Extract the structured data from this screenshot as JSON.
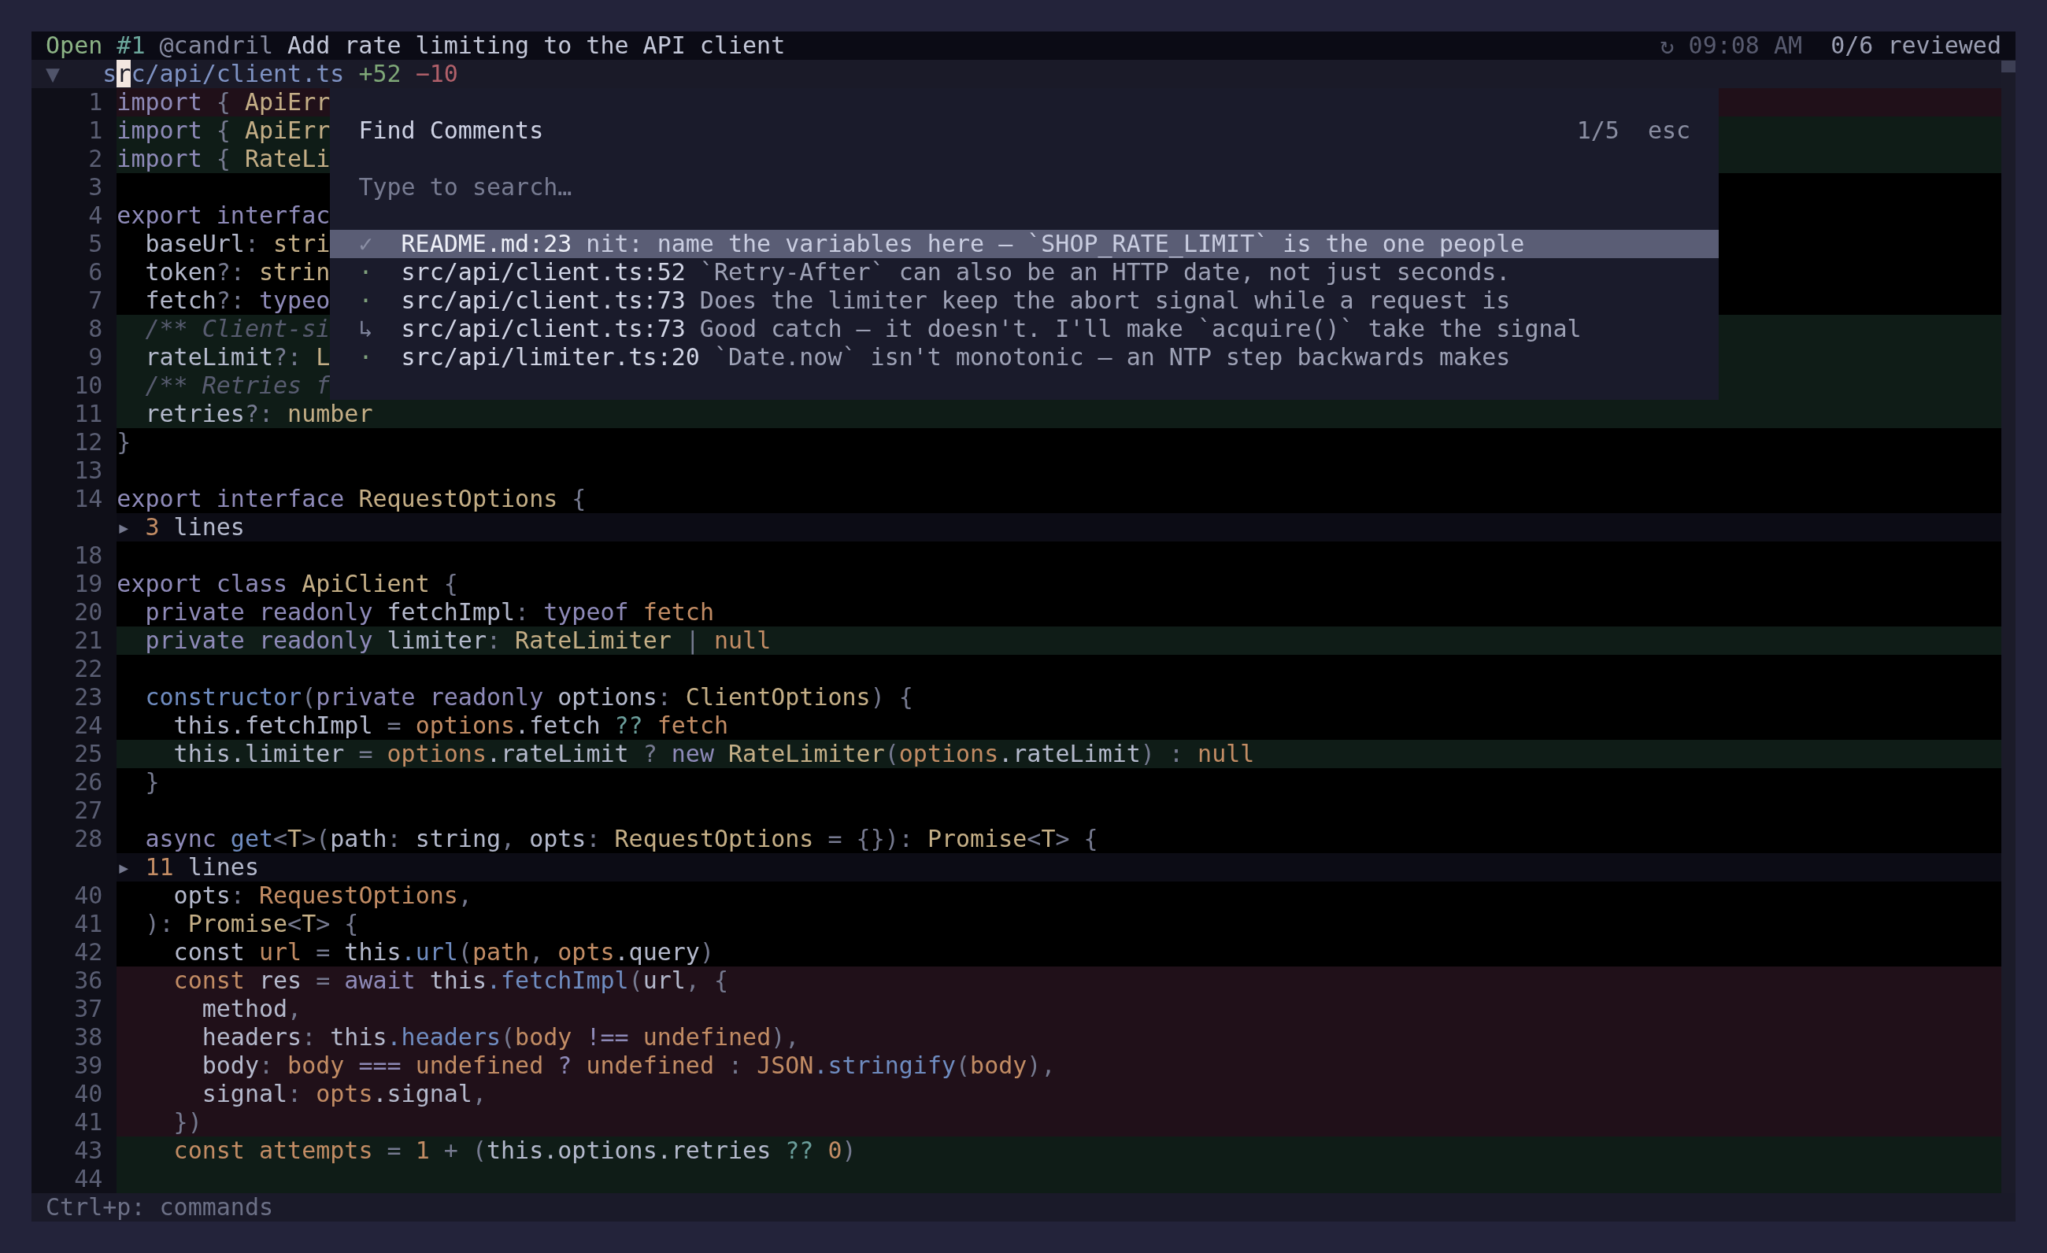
{
  "title_bar": {
    "state": "Open",
    "number": "#1",
    "author": "@candril",
    "title": "Add rate limiting to the API client",
    "refresh_glyph": "↻",
    "time": "09:08 AM",
    "reviewed_count": "0/6 reviewed"
  },
  "file_header": {
    "toggle": "▼",
    "path": [
      {
        "text": "s",
        "cursor": false
      },
      {
        "text": "r",
        "cursor": true
      },
      {
        "text": "c/api/client.ts",
        "cursor": false
      }
    ],
    "additions": "+52",
    "deletions": "−10"
  },
  "diff_lines": [
    {
      "kind": "removed",
      "number": "1",
      "code": [
        {
          "kind": "kw",
          "text": "import"
        },
        {
          "kind": "punct",
          "text": " { "
        },
        {
          "kind": "type",
          "text": "ApiErr"
        }
      ]
    },
    {
      "kind": "added",
      "number": "1",
      "code": [
        {
          "kind": "kw",
          "text": "import"
        },
        {
          "kind": "punct",
          "text": " { "
        },
        {
          "kind": "type",
          "text": "ApiErr"
        }
      ]
    },
    {
      "kind": "added",
      "number": "2",
      "code": [
        {
          "kind": "kw",
          "text": "import"
        },
        {
          "kind": "punct",
          "text": " { "
        },
        {
          "kind": "type",
          "text": "RateLi"
        }
      ]
    },
    {
      "kind": "context",
      "number": "3"
    },
    {
      "kind": "context",
      "number": "4",
      "code": [
        {
          "kind": "kw",
          "text": "export interfac"
        }
      ]
    },
    {
      "kind": "context",
      "number": "5",
      "code": [
        {
          "kind": "id",
          "text": "  baseUrl"
        },
        {
          "kind": "punct",
          "text": ": "
        },
        {
          "kind": "type",
          "text": "stri"
        }
      ]
    },
    {
      "kind": "context",
      "number": "6",
      "code": [
        {
          "kind": "id",
          "text": "  token"
        },
        {
          "kind": "punct",
          "text": "?: "
        },
        {
          "kind": "type",
          "text": "strin"
        }
      ]
    },
    {
      "kind": "context",
      "number": "7",
      "code": [
        {
          "kind": "id",
          "text": "  fetch"
        },
        {
          "kind": "punct",
          "text": "?: "
        },
        {
          "kind": "kw",
          "text": "typeo"
        }
      ]
    },
    {
      "kind": "added",
      "number": "8",
      "code": [
        {
          "kind": "cmt",
          "text": "  /** Client-si"
        }
      ]
    },
    {
      "kind": "added",
      "number": "9",
      "code": [
        {
          "kind": "id",
          "text": "  rateLimit"
        },
        {
          "kind": "punct",
          "text": "?: "
        },
        {
          "kind": "type",
          "text": "L"
        }
      ]
    },
    {
      "kind": "added",
      "number": "10",
      "code": [
        {
          "kind": "cmt",
          "text": "  /** Retries f"
        }
      ]
    },
    {
      "kind": "added",
      "number": "11",
      "code": [
        {
          "kind": "id",
          "text": "  retries"
        },
        {
          "kind": "punct",
          "text": "?: "
        },
        {
          "kind": "type",
          "text": "number"
        }
      ]
    },
    {
      "kind": "context",
      "number": "12",
      "code": [
        {
          "kind": "punct",
          "text": "}"
        }
      ]
    },
    {
      "kind": "context",
      "number": "13"
    },
    {
      "kind": "context",
      "number": "14",
      "code": [
        {
          "kind": "kw",
          "text": "export interface "
        },
        {
          "kind": "type",
          "text": "RequestOptions"
        },
        {
          "kind": "punct",
          "text": " {"
        }
      ]
    },
    {
      "kind": "fold",
      "code": [
        {
          "kind": "punct",
          "text": "▸ "
        },
        {
          "kind": "val",
          "text": "3"
        },
        {
          "kind": "id",
          "text": " lines"
        }
      ]
    },
    {
      "kind": "context",
      "number": "18"
    },
    {
      "kind": "context",
      "number": "19",
      "code": [
        {
          "kind": "kw",
          "text": "export class "
        },
        {
          "kind": "type",
          "text": "ApiClient"
        },
        {
          "kind": "punct",
          "text": " {"
        }
      ]
    },
    {
      "kind": "context",
      "number": "20",
      "code": [
        {
          "kind": "kw",
          "text": "  private readonly "
        },
        {
          "kind": "id",
          "text": "fetchImpl"
        },
        {
          "kind": "punct",
          "text": ": "
        },
        {
          "kind": "kw",
          "text": "typeof "
        },
        {
          "kind": "val",
          "text": "fetch"
        }
      ]
    },
    {
      "kind": "added",
      "number": "21",
      "code": [
        {
          "kind": "kw",
          "text": "  private readonly "
        },
        {
          "kind": "id",
          "text": "limiter"
        },
        {
          "kind": "punct",
          "text": ": "
        },
        {
          "kind": "type",
          "text": "RateLimiter"
        },
        {
          "kind": "punct",
          "text": " | "
        },
        {
          "kind": "val",
          "text": "null"
        }
      ]
    },
    {
      "kind": "context",
      "number": "22"
    },
    {
      "kind": "context",
      "number": "23",
      "code": [
        {
          "kind": "fn",
          "text": "  constructor"
        },
        {
          "kind": "punct",
          "text": "("
        },
        {
          "kind": "kw",
          "text": "private readonly "
        },
        {
          "kind": "id",
          "text": "options"
        },
        {
          "kind": "punct",
          "text": ": "
        },
        {
          "kind": "type",
          "text": "ClientOptions"
        },
        {
          "kind": "punct",
          "text": ") {"
        }
      ]
    },
    {
      "kind": "context",
      "number": "24",
      "code": [
        {
          "kind": "id",
          "text": "    this.fetchImpl"
        },
        {
          "kind": "punct",
          "text": " = "
        },
        {
          "kind": "val",
          "text": "options"
        },
        {
          "kind": "id",
          "text": ".fetch "
        },
        {
          "kind": "op",
          "text": "??"
        },
        {
          "kind": "val",
          "text": " fetch"
        }
      ]
    },
    {
      "kind": "added",
      "number": "25",
      "code": [
        {
          "kind": "id",
          "text": "    this.limiter"
        },
        {
          "kind": "punct",
          "text": " = "
        },
        {
          "kind": "val",
          "text": "options"
        },
        {
          "kind": "id",
          "text": ".rateLimit"
        },
        {
          "kind": "punct",
          "text": " ? "
        },
        {
          "kind": "kw",
          "text": "new "
        },
        {
          "kind": "type",
          "text": "RateLimiter"
        },
        {
          "kind": "punct",
          "text": "("
        },
        {
          "kind": "val",
          "text": "options"
        },
        {
          "kind": "id",
          "text": ".rateLimit"
        },
        {
          "kind": "punct",
          "text": ") : "
        },
        {
          "kind": "val",
          "text": "null"
        }
      ]
    },
    {
      "kind": "context",
      "number": "26",
      "code": [
        {
          "kind": "punct",
          "text": "  }"
        }
      ]
    },
    {
      "kind": "context",
      "number": "27"
    },
    {
      "kind": "context",
      "number": "28",
      "code": [
        {
          "kind": "kw",
          "text": "  async "
        },
        {
          "kind": "fn",
          "text": "get"
        },
        {
          "kind": "punct",
          "text": "<"
        },
        {
          "kind": "type",
          "text": "T"
        },
        {
          "kind": "punct",
          "text": ">("
        },
        {
          "kind": "id",
          "text": "path"
        },
        {
          "kind": "punct",
          "text": ": "
        },
        {
          "kind": "id",
          "text": "string"
        },
        {
          "kind": "punct",
          "text": ", "
        },
        {
          "kind": "id",
          "text": "opts"
        },
        {
          "kind": "punct",
          "text": ": "
        },
        {
          "kind": "type",
          "text": "RequestOptions"
        },
        {
          "kind": "punct",
          "text": " = {}): "
        },
        {
          "kind": "type",
          "text": "Promise"
        },
        {
          "kind": "punct",
          "text": "<"
        },
        {
          "kind": "type",
          "text": "T"
        },
        {
          "kind": "punct",
          "text": "> {"
        }
      ]
    },
    {
      "kind": "fold",
      "code": [
        {
          "kind": "punct",
          "text": "▸ "
        },
        {
          "kind": "val",
          "text": "11"
        },
        {
          "kind": "id",
          "text": " lines"
        }
      ]
    },
    {
      "kind": "context",
      "number": "40",
      "code": [
        {
          "kind": "id",
          "text": "    opts"
        },
        {
          "kind": "punct",
          "text": ": "
        },
        {
          "kind": "val",
          "text": "RequestOptions"
        },
        {
          "kind": "punct",
          "text": ","
        }
      ]
    },
    {
      "kind": "context",
      "number": "41",
      "code": [
        {
          "kind": "punct",
          "text": "  ): "
        },
        {
          "kind": "type",
          "text": "Promise"
        },
        {
          "kind": "punct",
          "text": "<"
        },
        {
          "kind": "type",
          "text": "T"
        },
        {
          "kind": "punct",
          "text": "> {"
        }
      ]
    },
    {
      "kind": "context",
      "number": "42",
      "code": [
        {
          "kind": "id",
          "text": "    const "
        },
        {
          "kind": "val",
          "text": "url"
        },
        {
          "kind": "punct",
          "text": " = "
        },
        {
          "kind": "id",
          "text": "this"
        },
        {
          "kind": "fn",
          "text": ".url"
        },
        {
          "kind": "punct",
          "text": "("
        },
        {
          "kind": "val",
          "text": "path"
        },
        {
          "kind": "punct",
          "text": ", "
        },
        {
          "kind": "val",
          "text": "opts"
        },
        {
          "kind": "id",
          "text": ".query"
        },
        {
          "kind": "punct",
          "text": ")"
        }
      ]
    },
    {
      "kind": "removed",
      "number": "36",
      "code": [
        {
          "kind": "val",
          "text": "    const "
        },
        {
          "kind": "id",
          "text": "res"
        },
        {
          "kind": "punct",
          "text": " = "
        },
        {
          "kind": "kw",
          "text": "await "
        },
        {
          "kind": "id",
          "text": "this"
        },
        {
          "kind": "fn",
          "text": ".fetchImpl"
        },
        {
          "kind": "punct",
          "text": "("
        },
        {
          "kind": "id",
          "text": "url"
        },
        {
          "kind": "punct",
          "text": ", {"
        }
      ]
    },
    {
      "kind": "removed",
      "number": "37",
      "code": [
        {
          "kind": "id",
          "text": "      method"
        },
        {
          "kind": "punct",
          "text": ","
        }
      ]
    },
    {
      "kind": "removed",
      "number": "38",
      "code": [
        {
          "kind": "id",
          "text": "      headers"
        },
        {
          "kind": "punct",
          "text": ": "
        },
        {
          "kind": "id",
          "text": "this"
        },
        {
          "kind": "fn",
          "text": ".headers"
        },
        {
          "kind": "punct",
          "text": "("
        },
        {
          "kind": "val",
          "text": "body"
        },
        {
          "kind": "kw",
          "text": " !== "
        },
        {
          "kind": "val",
          "text": "undefined"
        },
        {
          "kind": "punct",
          "text": "),"
        }
      ]
    },
    {
      "kind": "removed",
      "number": "39",
      "code": [
        {
          "kind": "id",
          "text": "      body"
        },
        {
          "kind": "punct",
          "text": ": "
        },
        {
          "kind": "val",
          "text": "body"
        },
        {
          "kind": "kw",
          "text": " === "
        },
        {
          "kind": "val",
          "text": "undefined"
        },
        {
          "kind": "kw",
          "text": " ? "
        },
        {
          "kind": "val",
          "text": "undefined"
        },
        {
          "kind": "punct",
          "text": " : "
        },
        {
          "kind": "val",
          "text": "JSON"
        },
        {
          "kind": "fn",
          "text": ".stringify"
        },
        {
          "kind": "punct",
          "text": "("
        },
        {
          "kind": "val",
          "text": "body"
        },
        {
          "kind": "punct",
          "text": "),"
        }
      ]
    },
    {
      "kind": "removed",
      "number": "40",
      "code": [
        {
          "kind": "id",
          "text": "      signal"
        },
        {
          "kind": "punct",
          "text": ": "
        },
        {
          "kind": "val",
          "text": "opts"
        },
        {
          "kind": "id",
          "text": ".signal"
        },
        {
          "kind": "punct",
          "text": ","
        }
      ]
    },
    {
      "kind": "removed",
      "number": "41",
      "code": [
        {
          "kind": "punct",
          "text": "    })"
        }
      ]
    },
    {
      "kind": "added",
      "number": "43",
      "code": [
        {
          "kind": "val",
          "text": "    const attempts"
        },
        {
          "kind": "punct",
          "text": " = "
        },
        {
          "kind": "val",
          "text": "1"
        },
        {
          "kind": "punct",
          "text": " + ("
        },
        {
          "kind": "id",
          "text": "this.options.retries "
        },
        {
          "kind": "op",
          "text": "??"
        },
        {
          "kind": "val",
          "text": " 0"
        },
        {
          "kind": "punct",
          "text": ")"
        }
      ]
    },
    {
      "kind": "added",
      "number": "44"
    }
  ],
  "find_comments": {
    "title": "Find Comments",
    "count": "1/5",
    "close_key": "esc",
    "search": {
      "placeholder": "Type to search…"
    },
    "results": [
      {
        "selected": true,
        "kind": "done",
        "marker": "✓",
        "location": "README.md:23",
        "text": "nit: name the variables here — `SHOP_RATE_LIMIT` is the one people"
      },
      {
        "selected": false,
        "kind": "open",
        "marker": "·",
        "location": "src/api/client.ts:52",
        "text": "`Retry-After` can also be an HTTP date, not just seconds."
      },
      {
        "selected": false,
        "kind": "open",
        "marker": "·",
        "location": "src/api/client.ts:73",
        "text": "Does the limiter keep the abort signal while a request is"
      },
      {
        "selected": false,
        "kind": "reply",
        "marker": "↳",
        "location": "src/api/client.ts:73",
        "text": "Good catch — it doesn't. I'll make `acquire()` take the signal"
      },
      {
        "selected": false,
        "kind": "open",
        "marker": "·",
        "location": "src/api/limiter.ts:20",
        "text": "`Date.now` isn't monotonic — an NTP step backwards makes"
      }
    ]
  },
  "status_bar": {
    "hint": "Ctrl+p: commands"
  }
}
